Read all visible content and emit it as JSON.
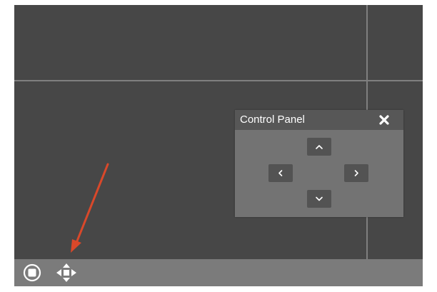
{
  "control_panel": {
    "title": "Control Panel",
    "close_icon": "close-x-icon",
    "buttons": [
      {
        "name": "pan-up-button",
        "icon": "chevron-up-icon"
      },
      {
        "name": "pan-left-button",
        "icon": "chevron-left-icon"
      },
      {
        "name": "pan-right-button",
        "icon": "chevron-right-icon"
      },
      {
        "name": "pan-down-button",
        "icon": "chevron-down-icon"
      }
    ]
  },
  "toolbar": {
    "items": [
      {
        "name": "stop-button",
        "icon": "stop-circle-icon"
      },
      {
        "name": "move-button",
        "icon": "move-arrows-icon"
      }
    ]
  },
  "colors": {
    "viewport_background": "#474747",
    "grid_lines": "#7f7f7f",
    "toolbar_background": "#7b7b7b",
    "panel_background": "#737373",
    "panel_header": "#575757",
    "direction_button": "#535353",
    "icon": "#ffffff",
    "annotation_arrow": "#d9482a"
  }
}
